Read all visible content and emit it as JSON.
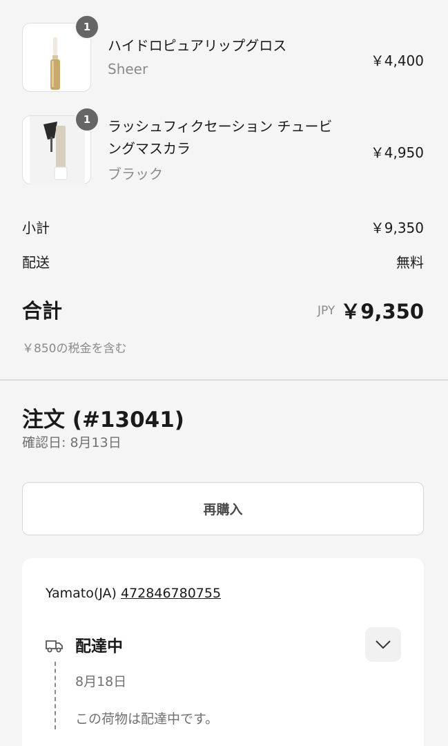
{
  "items": [
    {
      "quantity": "1",
      "name": "ハイドロピュアリップグロス",
      "variant": "Sheer",
      "price": "￥4,400"
    },
    {
      "quantity": "1",
      "name": "ラッシュフィクセーション チュービングマスカラ",
      "variant": "ブラック",
      "price": "￥4,950"
    }
  ],
  "summary": {
    "subtotal_label": "小計",
    "subtotal_value": "￥9,350",
    "shipping_label": "配送",
    "shipping_value": "無料",
    "total_label": "合計",
    "currency": "JPY",
    "total_value": "￥9,350",
    "tax_note": "￥850の税金を含む"
  },
  "order": {
    "title": "注文 (#13041)",
    "confirmed": "確認日: 8月13日",
    "rebuy_label": "再購入"
  },
  "shipment": {
    "carrier": "Yamato(JA)",
    "tracking_number": "472846780755",
    "status": "配達中",
    "status_icon": "truck-icon",
    "event_date": "8月18日",
    "event_message": "この荷物は配達中です。"
  }
}
